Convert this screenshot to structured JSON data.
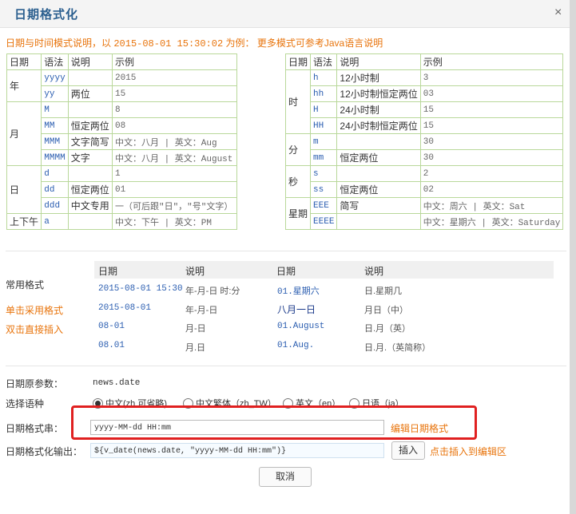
{
  "dialog": {
    "title": "日期格式化",
    "close_glyph": "×"
  },
  "hint": {
    "prefix": "日期与时间模式说明，以 ",
    "example": "2015-08-01 15:30:02",
    "suffix": " 为例：",
    "more": " 更多模式可参考Java语言说明"
  },
  "left_table": {
    "headers": [
      "日期",
      "语法",
      "说明",
      "示例"
    ],
    "rows": [
      {
        "group": "年",
        "code": "yyyy",
        "desc": "",
        "ex": "2015"
      },
      {
        "group": "",
        "code": "yy",
        "desc": "两位",
        "ex": "15"
      },
      {
        "group": "月",
        "code": "M",
        "desc": "",
        "ex": "8"
      },
      {
        "group": "",
        "code": "MM",
        "desc": "恒定两位",
        "ex": "08"
      },
      {
        "group": "",
        "code": "MMM",
        "desc": "文字简写",
        "ex": "中文：八月 | 英文：Aug"
      },
      {
        "group": "",
        "code": "MMMM",
        "desc": "文字",
        "ex": "中文：八月 | 英文：August"
      },
      {
        "group": "日",
        "code": "d",
        "desc": "",
        "ex": "1"
      },
      {
        "group": "",
        "code": "dd",
        "desc": "恒定两位",
        "ex": "01"
      },
      {
        "group": "",
        "code": "ddd",
        "desc": "中文专用",
        "ex": "一（可后跟\"日\"，\"号\"文字）"
      },
      {
        "group": "上下午",
        "code": "a",
        "desc": "",
        "ex": "中文：下午 | 英文：PM"
      }
    ]
  },
  "right_table": {
    "headers": [
      "日期",
      "语法",
      "说明",
      "示例"
    ],
    "rows": [
      {
        "group": "时",
        "code": "h",
        "desc": "12小时制",
        "ex": "3"
      },
      {
        "group": "",
        "code": "hh",
        "desc": "12小时制恒定两位",
        "ex": "03"
      },
      {
        "group": "",
        "code": "H",
        "desc": "24小时制",
        "ex": "15"
      },
      {
        "group": "",
        "code": "HH",
        "desc": "24小时制恒定两位",
        "ex": "15"
      },
      {
        "group": "分",
        "code": "m",
        "desc": "",
        "ex": "30"
      },
      {
        "group": "",
        "code": "mm",
        "desc": "恒定两位",
        "ex": "30"
      },
      {
        "group": "秒",
        "code": "s",
        "desc": "",
        "ex": "2"
      },
      {
        "group": "",
        "code": "ss",
        "desc": "恒定两位",
        "ex": "02"
      },
      {
        "group": "星期",
        "code": "EEE",
        "desc": "简写",
        "ex": "中文：周六 | 英文：Sat"
      },
      {
        "group": "",
        "code": "EEEE",
        "desc": "",
        "ex": "中文：星期六 | 英文：Saturday"
      }
    ]
  },
  "common": {
    "label": "常用格式",
    "use_label": "单击采用格式",
    "insert_label": "双击直接插入",
    "headers": [
      "日期",
      "说明",
      "日期",
      "说明"
    ],
    "rows": [
      {
        "d1": "2015-08-01 15:30",
        "s1": "年-月-日 时:分",
        "d2": "01.星期六",
        "s2": "日.星期几"
      },
      {
        "d1": "2015-08-01",
        "s1": "年-月-日",
        "d2": "八月一日",
        "s2": "月日（中）"
      },
      {
        "d1": "08-01",
        "s1": "月-日",
        "d2": "01.August",
        "s2": "日.月（英）"
      },
      {
        "d1": "08.01",
        "s1": "月.日",
        "d2": "01.Aug.",
        "s2": "日.月.（英简称）"
      }
    ]
  },
  "form": {
    "param_label": "日期原参数：",
    "param_value": "news.date",
    "lang_label": "选择语种",
    "languages": [
      {
        "label": "中文(zh 可省略)",
        "checked": true
      },
      {
        "label": "中文繁体（zh_TW）",
        "checked": false
      },
      {
        "label": "英文（en）",
        "checked": false
      },
      {
        "label": "日语（ja）",
        "checked": false
      }
    ],
    "format_label": "日期格式串：",
    "format_value": "yyyy-MM-dd HH:mm",
    "edit_link": "编辑日期格式",
    "output_label": "日期格式化输出：",
    "output_value": "${v_date(news.date, \"yyyy-MM-dd HH:mm\")}",
    "insert_button": "插入",
    "insert_hint": "点击插入到编辑区",
    "cancel_button": "取消"
  },
  "colors": {
    "accent_orange": "#e8740c",
    "table_border": "#b9d89a",
    "highlight_red": "#e02020",
    "link_blue": "#2a5db0"
  }
}
